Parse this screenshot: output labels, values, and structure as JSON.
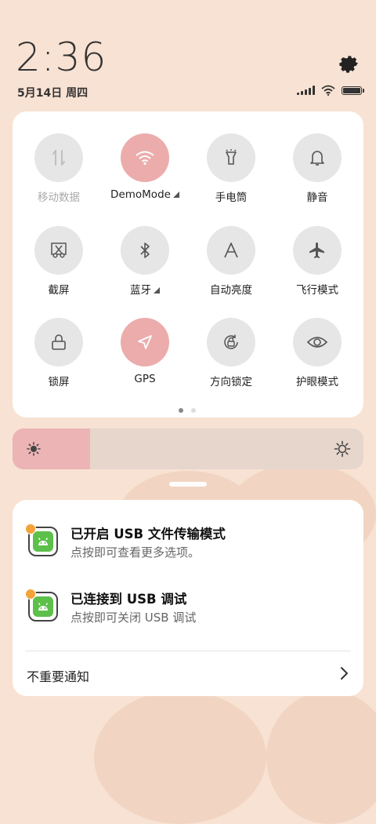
{
  "status_bar": {
    "time": "2:36",
    "date": "5月14日 周四"
  },
  "quick_settings": {
    "tiles": [
      {
        "label": "移动数据",
        "icon": "mobile-data-icon",
        "state": "disabled"
      },
      {
        "label": "DemoMode",
        "icon": "wifi-icon",
        "state": "on"
      },
      {
        "label": "手电筒",
        "icon": "flashlight-icon",
        "state": "off"
      },
      {
        "label": "静音",
        "icon": "bell-icon",
        "state": "off"
      },
      {
        "label": "截屏",
        "icon": "screenshot-icon",
        "state": "off"
      },
      {
        "label": "蓝牙",
        "icon": "bluetooth-icon",
        "state": "off"
      },
      {
        "label": "自动亮度",
        "icon": "auto-brightness-icon",
        "state": "off"
      },
      {
        "label": "飞行模式",
        "icon": "airplane-icon",
        "state": "off"
      },
      {
        "label": "锁屏",
        "icon": "lock-icon",
        "state": "off"
      },
      {
        "label": "GPS",
        "icon": "location-icon",
        "state": "on"
      },
      {
        "label": "方向锁定",
        "icon": "rotation-lock-icon",
        "state": "off"
      },
      {
        "label": "护眼模式",
        "icon": "eye-icon",
        "state": "off"
      }
    ],
    "page_count": 2,
    "current_page": 1
  },
  "brightness": {
    "level": 0.22
  },
  "notifications": [
    {
      "title": "已开启 USB 文件传输模式",
      "subtitle": "点按即可查看更多选项。"
    },
    {
      "title": "已连接到 USB 调试",
      "subtitle": "点按即可关闭 USB 调试"
    }
  ],
  "unimportant_label": "不重要通知",
  "colors": {
    "accent": "#ecacac",
    "background": "#f8e2d3",
    "app_green": "#5cc04a"
  }
}
